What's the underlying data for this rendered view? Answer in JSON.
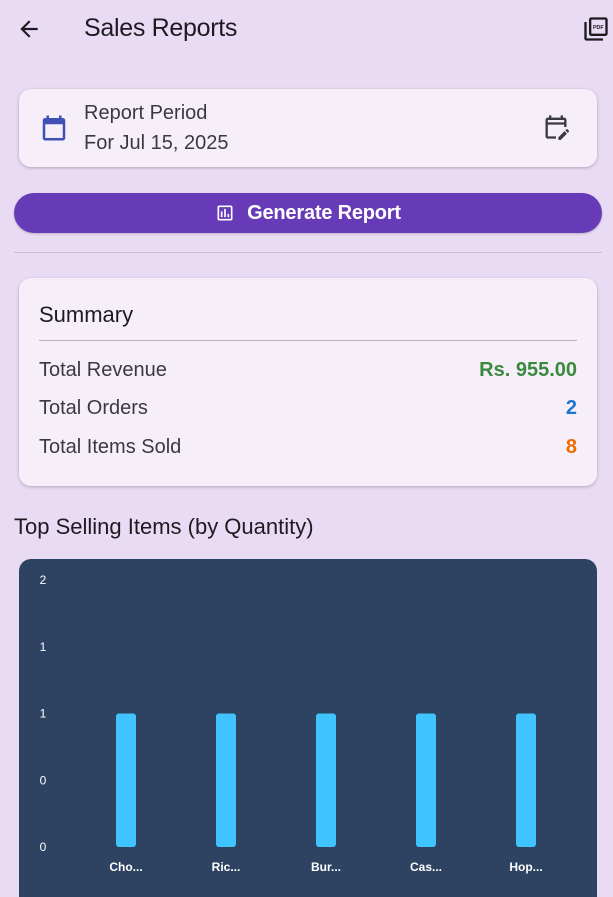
{
  "appbar": {
    "title": "Sales Reports",
    "back_icon": "arrow-back-icon",
    "pdf_icon": "picture-as-pdf-icon"
  },
  "period": {
    "label": "Report Period",
    "value": "For Jul 15, 2025",
    "calendar_icon": "calendar-icon",
    "edit_icon": "edit-calendar-icon"
  },
  "generate": {
    "label": "Generate Report",
    "icon": "bar-chart-icon"
  },
  "summary": {
    "title": "Summary",
    "rows": [
      {
        "label": "Total Revenue",
        "value": "Rs. 955.00",
        "color": "#3a8a3e"
      },
      {
        "label": "Total Orders",
        "value": "2",
        "color": "#1976d2"
      },
      {
        "label": "Total Items Sold",
        "value": "8",
        "color": "#ef6c00"
      }
    ]
  },
  "chart_section": {
    "title": "Top Selling Items (by Quantity)"
  },
  "chart_data": {
    "type": "bar",
    "categories": [
      "Cho...",
      "Ric...",
      "Bur...",
      "Cas...",
      "Hop..."
    ],
    "values": [
      1,
      1,
      1,
      1,
      1
    ],
    "ylim": [
      0,
      2
    ],
    "yticks": [
      {
        "value": 0,
        "label": "0"
      },
      {
        "value": 0.5,
        "label": "0"
      },
      {
        "value": 1,
        "label": "1"
      },
      {
        "value": 1.5,
        "label": "1"
      },
      {
        "value": 2,
        "label": "2"
      }
    ],
    "bar_color": "#40c4ff",
    "background": "#2e4361",
    "grid": false
  }
}
